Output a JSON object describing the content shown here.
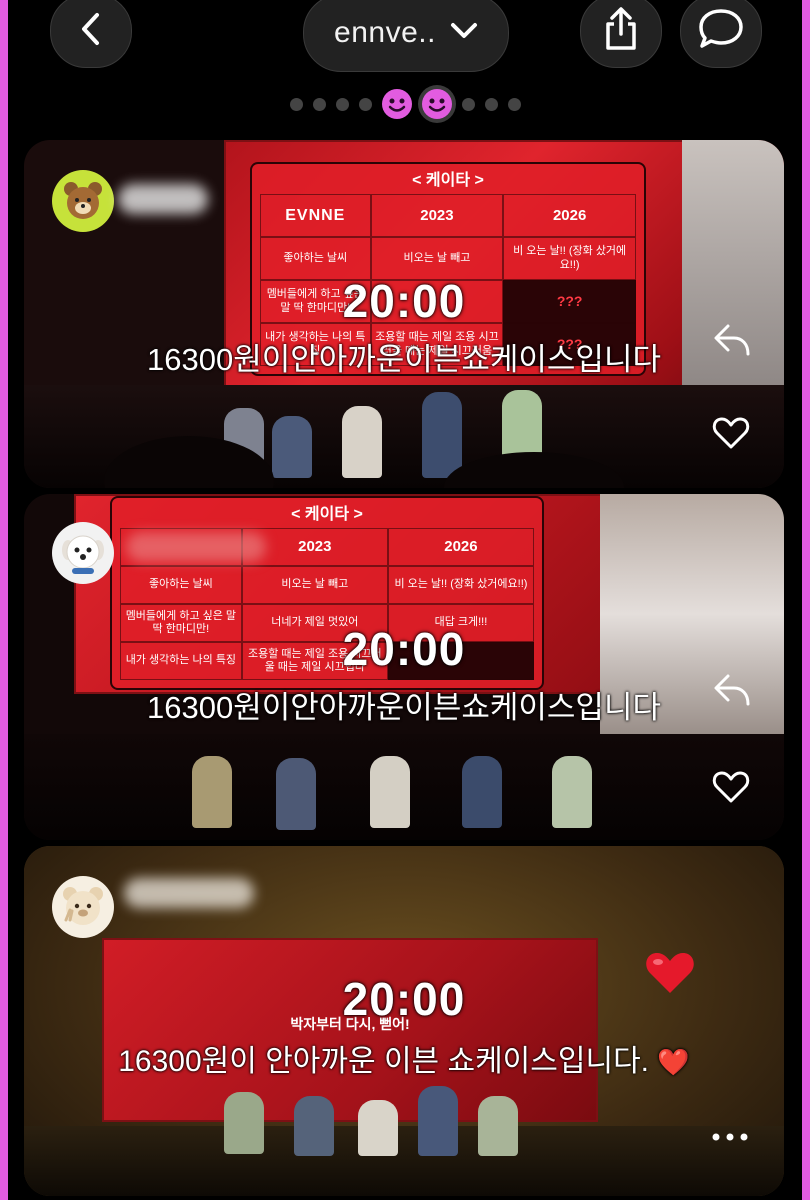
{
  "header": {
    "title": "ennve..",
    "back_icon": "chevron-left-icon",
    "dropdown_icon": "chevron-down-icon",
    "share_icon": "share-icon",
    "message_icon": "message-bubble-icon",
    "page_dots": 9,
    "active_dot_index": 5
  },
  "colors": {
    "accent_pink": "#e25ce0",
    "stage_red": "#e0242d",
    "heart_red": "#e5192b"
  },
  "stories": [
    {
      "avatar_icon": "bear-avatar-icon",
      "time_sticker": "20:00",
      "caption": "16300원이안아까운이븐쇼케이스입니다",
      "panel": {
        "title": "< 케이타 >",
        "brand": "EVNNE",
        "col_headers": [
          "2023",
          "2026"
        ],
        "rows": [
          {
            "label": "좋아하는 날씨",
            "y2023": "비오는 날 빼고",
            "y2026": "비 오는 날!! (장화 샀거에요!!)"
          },
          {
            "label": "멤버들에게 하고 싶은 말 딱 한마디만!",
            "y2023": "",
            "y2026": "???"
          },
          {
            "label": "내가 생각하는 나의 특징",
            "y2023": "조용할 때는 제일 조용 시끄러울 때는 제일 시끄러움",
            "y2026": "???"
          }
        ]
      },
      "reply_icon": "reply-arrow-icon",
      "heart_icon": "heart-outline-icon"
    },
    {
      "avatar_icon": "puppy-avatar-icon",
      "time_sticker": "20:00",
      "caption": "16300원이안아까운이븐쇼케이스입니다",
      "panel": {
        "title": "< 케이타 >",
        "col_headers": [
          "2023",
          "2026"
        ],
        "rows": [
          {
            "label": "좋아하는 날씨",
            "y2023": "비오는 날 빼고",
            "y2026": "비 오는 날!! (장화 샀거에요!!)"
          },
          {
            "label": "멤버들에게 하고 싶은 말 딱 한마디만!",
            "y2023": "너네가 제일 멋있어",
            "y2026": "대답 크게!!!"
          },
          {
            "label": "내가 생각하는 나의 특징",
            "y2023": "조용할 때는 제일 조용 시끄러울 때는 제일 시끄럽다",
            "y2026": ""
          }
        ]
      },
      "reply_icon": "reply-arrow-icon",
      "heart_icon": "heart-outline-icon"
    },
    {
      "avatar_icon": "bear-peace-avatar-icon",
      "time_sticker": "20:00",
      "screen_text": "박자부터 다시, 뻗어!",
      "caption": "16300원이 안아까운 이븐 쇼케이스입니다.",
      "heart_emoji": "❤️",
      "more_icon": "more-dots-icon"
    }
  ]
}
